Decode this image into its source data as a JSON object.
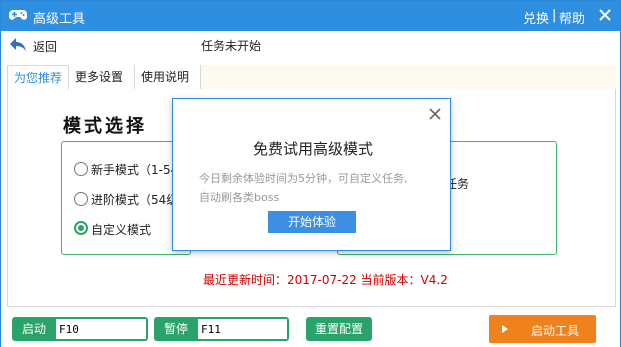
{
  "app": {
    "title": "高级工具",
    "redeem": "兑换",
    "separator": "|",
    "help": "帮助"
  },
  "toolbar": {
    "back": "返回",
    "task_status": "任务未开始"
  },
  "tabs": [
    {
      "label": "为您推荐",
      "active": true
    },
    {
      "label": "更多设置"
    },
    {
      "label": "使用说明"
    }
  ],
  "mode": {
    "title": "模式选择",
    "options": [
      {
        "label": "新手模式（1-54",
        "checked": false
      },
      {
        "label": "进阶模式（54级",
        "checked": false
      },
      {
        "label": "自定义模式",
        "checked": true
      }
    ],
    "right_text": "任务"
  },
  "update_info": "最近更新时间：2017-07-22  当前版本：V4.2",
  "popup": {
    "title": "免费试用高级模式",
    "desc_line1": "今日剩余体验时间为5分钟，可自定义任务,",
    "desc_line2": "自动刷各类boss",
    "button": "开始体验"
  },
  "bottom": {
    "start_label": "启动",
    "start_key": "F10",
    "pause_label": "暂停",
    "pause_key": "F11",
    "reset": "重置配置",
    "launch": "启动工具"
  },
  "colors": {
    "titlebar": "#2e8ee0",
    "green": "#2aa36b",
    "orange": "#f0821e",
    "update_red": "#d40000"
  }
}
